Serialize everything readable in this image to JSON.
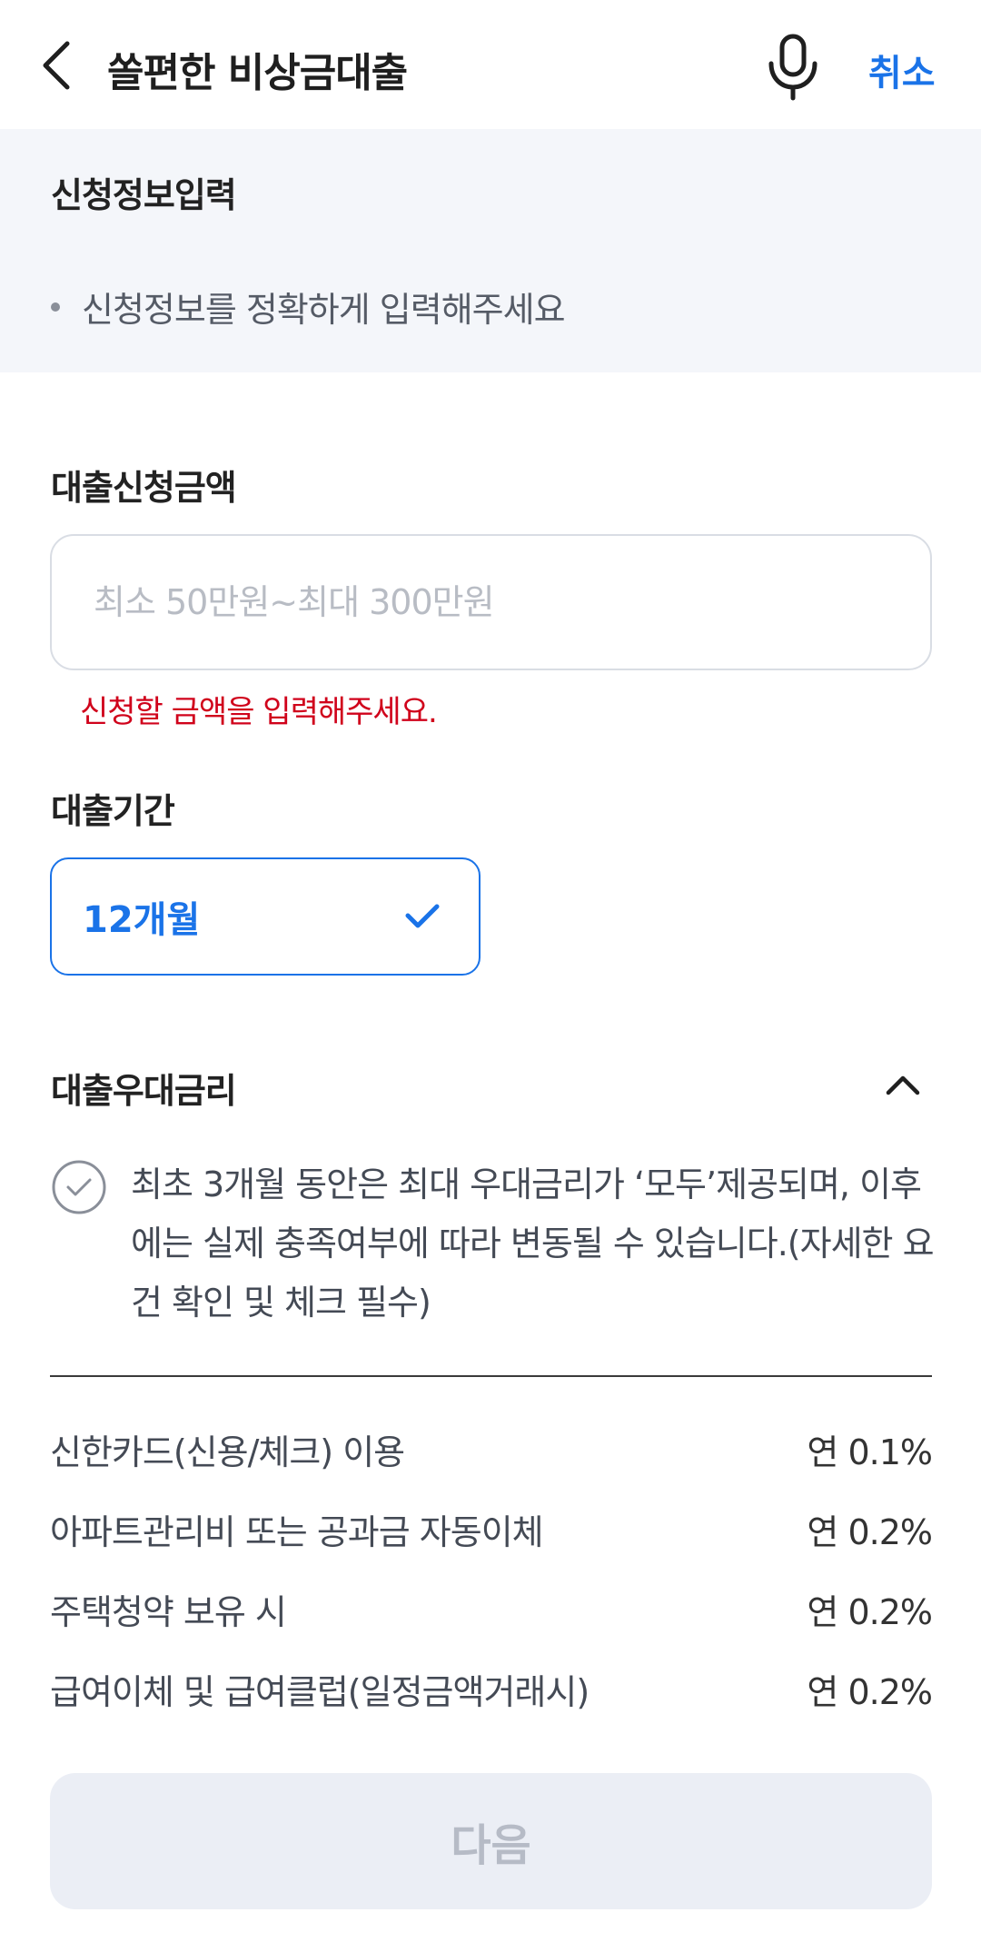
{
  "header": {
    "title": "쏠편한 비상금대출",
    "cancel_label": "취소"
  },
  "info": {
    "title": "신청정보입력",
    "bullet": "신청정보를 정확하게 입력해주세요"
  },
  "amount": {
    "label": "대출신청금액",
    "value": "",
    "placeholder": "최소 50만원~최대 300만원",
    "error": "신청할 금액을 입력해주세요."
  },
  "period": {
    "label": "대출기간",
    "selected": "12개월"
  },
  "preferential": {
    "label": "대출우대금리",
    "consent_text": "최초 3개월 동안은 최대 우대금리가 ‘모두’제공되며, 이후에는 실제 충족여부에 따라 변동될 수 있습니다.(자세한 요건 확인 및 체크 필수)",
    "items": [
      {
        "name": "신한카드(신용/체크) 이용",
        "rate": "연 0.1%"
      },
      {
        "name": "아파트관리비 또는 공과금 자동이체",
        "rate": "연 0.2%"
      },
      {
        "name": "주택청약 보유 시",
        "rate": "연 0.2%"
      },
      {
        "name": "급여이체 및 급여클럽(일정금액거래시)",
        "rate": "연 0.2%"
      }
    ]
  },
  "footer": {
    "next_label": "다음"
  },
  "colors": {
    "accent": "#1a73e8",
    "error": "#d0021b",
    "info_bg": "#f4f6fa",
    "disabled_bg": "#ebeef5"
  },
  "icons": {
    "back": "chevron-left-icon",
    "mic": "microphone-icon",
    "select_check": "checkmark-icon",
    "collapse": "chevron-up-icon",
    "consent": "circle-check-icon"
  }
}
